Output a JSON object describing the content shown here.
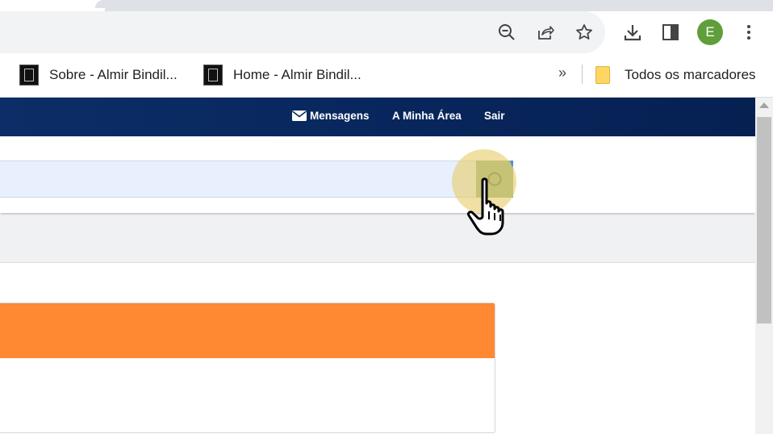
{
  "browser": {
    "profile_initial": "E",
    "bookmarks": [
      {
        "label": "Sobre - Almir Bindil..."
      },
      {
        "label": "Home - Almir Bindil..."
      }
    ],
    "more_bookmarks": "»",
    "all_bookmarks_label": "Todos os marcadores",
    "icons": [
      "zoom-out-icon",
      "share-icon",
      "star-icon",
      "download-icon",
      "side-panel-icon",
      "more-vert-icon"
    ]
  },
  "site": {
    "nav": {
      "messages": "Mensagens",
      "my_area": "A Minha Área",
      "logout": "Sair"
    },
    "search": {
      "placeholder": "",
      "value": ""
    },
    "colors": {
      "navbar": "#0a2a62",
      "card_header": "#ff8833",
      "search_field": "#e8f0fe",
      "search_button_highlighted": "#90b48a"
    }
  }
}
